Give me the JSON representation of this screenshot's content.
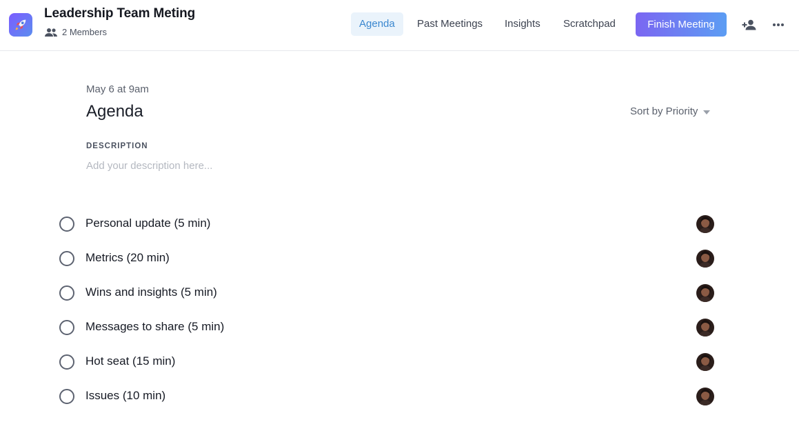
{
  "header": {
    "title": "Leadership Team Meting",
    "members_text": "2 Members",
    "tabs": [
      {
        "label": "Agenda",
        "active": true
      },
      {
        "label": "Past Meetings",
        "active": false
      },
      {
        "label": "Insights",
        "active": false
      },
      {
        "label": "Scratchpad",
        "active": false
      }
    ],
    "finish_label": "Finish Meeting"
  },
  "icons": {
    "app": "rocket-icon",
    "members": "people-icon",
    "add_member": "add-person-icon",
    "more": "more-horizontal-icon",
    "sort": "caret-down-icon",
    "checkbox": "circle-checkbox-icon"
  },
  "colors": {
    "accent": "#3a87cf",
    "active_tab_bg": "#eaf3fb",
    "button_gradient_start": "#7b66f2",
    "button_gradient_end": "#5c9df3"
  },
  "main": {
    "date": "May 6 at 9am",
    "heading": "Agenda",
    "sort_label": "Sort by Priority",
    "description_label": "DESCRIPTION",
    "description_value": "",
    "description_placeholder": "Add your description here..."
  },
  "agenda_items": [
    {
      "label": "Personal update (5 min)",
      "done": false
    },
    {
      "label": "Metrics (20 min)",
      "done": false
    },
    {
      "label": "Wins and insights (5 min)",
      "done": false
    },
    {
      "label": "Messages to share (5 min)",
      "done": false
    },
    {
      "label": "Hot seat (15 min)",
      "done": false
    },
    {
      "label": "Issues (10 min)",
      "done": false
    }
  ]
}
